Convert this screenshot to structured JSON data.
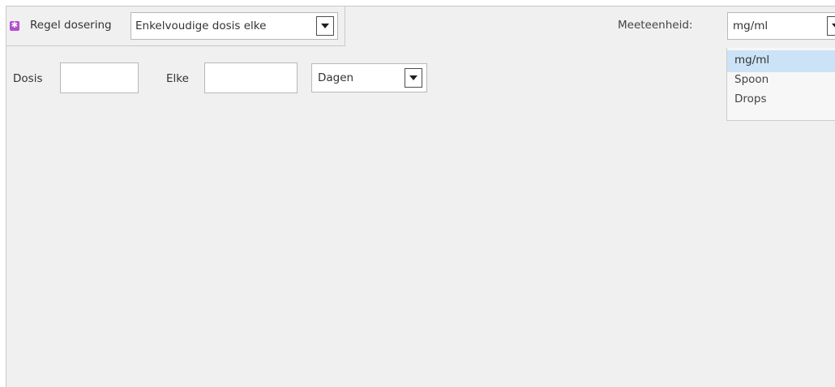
{
  "dosing_rule": {
    "label": "Regel dosering",
    "value": "Enkelvoudige dosis elke",
    "required_icon": "asterisk-icon"
  },
  "unit": {
    "label": "Meeteenheid:",
    "value": "mg/ml",
    "options": [
      "mg/ml",
      "Spoon",
      "Drops"
    ],
    "selected_index": 0
  },
  "dose": {
    "label": "Dosis",
    "value": ""
  },
  "every": {
    "label": "Elke",
    "value": "",
    "period": "Dagen"
  },
  "colors": {
    "panel_bg": "#f0f0f0",
    "required_icon": "#b44fd0",
    "selected_option": "#cce3f7"
  }
}
